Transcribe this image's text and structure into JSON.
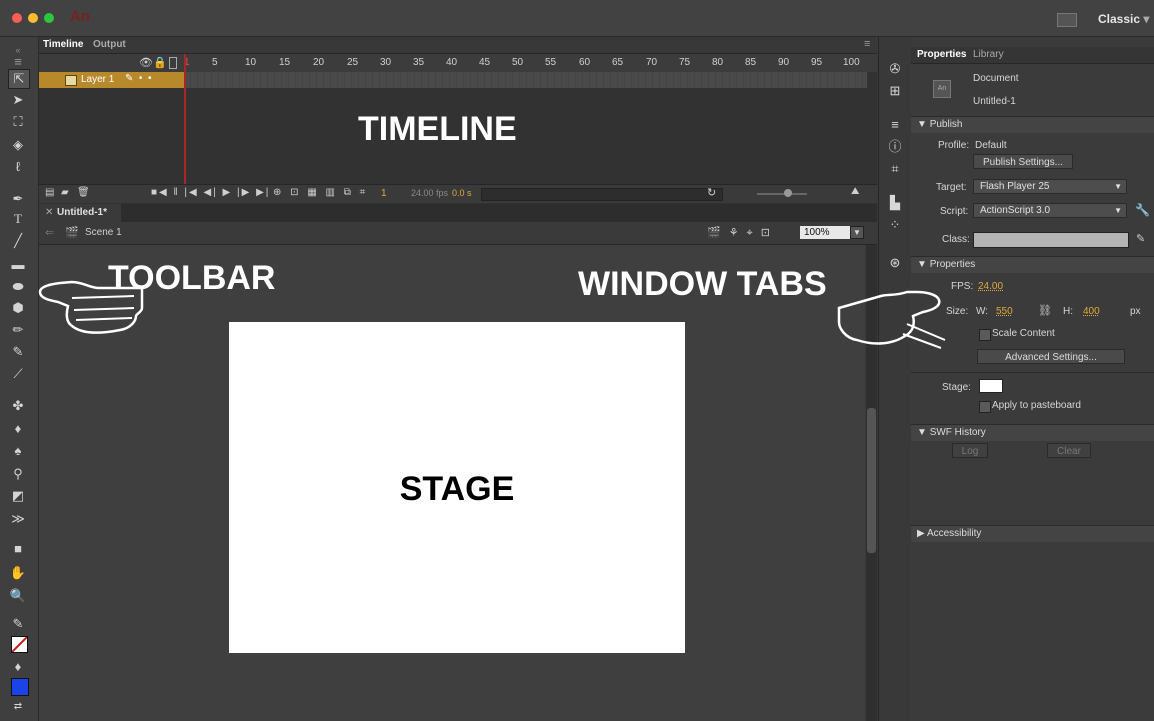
{
  "title_bar": {
    "app_logo": "An",
    "workspace": "Classic",
    "traffic_light_colors": [
      "#ff5f57",
      "#febc2e",
      "#28c840"
    ]
  },
  "toolbar": {
    "tools": [
      "selection",
      "subselection",
      "free-transform",
      "3d-rotation",
      "lasso",
      "pen",
      "text",
      "line",
      "rectangle",
      "oval",
      "polystar",
      "pencil",
      "paint-brush",
      "brush",
      "bone",
      "paint-bucket",
      "ink-bottle",
      "eyedropper",
      "eraser",
      "width",
      "camera",
      "hand",
      "zoom",
      "stroke-color",
      "fill-color"
    ],
    "stroke_color": "#ffffff",
    "fill_color": "#1a44e8"
  },
  "timeline": {
    "tabs": [
      "Timeline",
      "Output"
    ],
    "frame_numbers": [
      "1",
      "5",
      "10",
      "15",
      "20",
      "25",
      "30",
      "35",
      "40",
      "45",
      "50",
      "55",
      "60",
      "65",
      "70",
      "75",
      "80",
      "85",
      "90",
      "95",
      "100"
    ],
    "layer_name": "Layer 1",
    "layer_color": "#b8892a",
    "footer_frame": "1",
    "fps_readout": "24.00 fps",
    "time_readout": "0.0 s"
  },
  "document": {
    "tab": "Untitled-1*",
    "scene": "Scene 1",
    "zoom": "100%"
  },
  "icon_strip": [
    "color-icon",
    "swatches-icon",
    "align-icon",
    "info-icon",
    "transform-icon",
    "components-icon",
    "motion-presets-icon",
    "cc-libraries-icon"
  ],
  "properties": {
    "tabs": [
      "Properties",
      "Library"
    ],
    "doc_type": "Document",
    "doc_name": "Untitled-1",
    "publish_header": "Publish",
    "profile_label": "Profile:",
    "profile_value": "Default",
    "publish_settings_btn": "Publish Settings...",
    "target_label": "Target:",
    "target_value": "Flash Player 25",
    "script_label": "Script:",
    "script_value": "ActionScript 3.0",
    "class_label": "Class:",
    "properties_header": "Properties",
    "fps_label": "FPS:",
    "fps_value": "24.00",
    "size_label": "Size:",
    "w_label": "W:",
    "w_value": "550",
    "h_label": "H:",
    "h_value": "400",
    "unit": "px",
    "scale_content": "Scale Content",
    "advanced_settings_btn": "Advanced Settings...",
    "stage_label": "Stage:",
    "stage_color": "#ffffff",
    "apply_pasteboard": "Apply to pasteboard",
    "swf_history_header": "SWF History",
    "log_btn": "Log",
    "clear_btn": "Clear",
    "accessibility_header": "Accessibility"
  },
  "annotations": {
    "timeline": "TIMELINE",
    "toolbar": "TOOLBAR",
    "window_tabs": "WINDOW TABS",
    "stage": "STAGE"
  }
}
